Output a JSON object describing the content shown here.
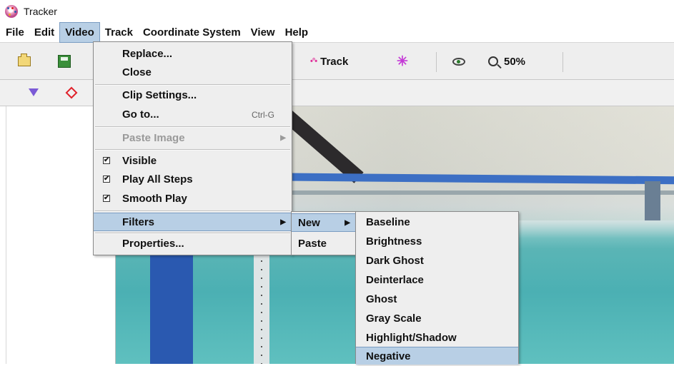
{
  "window": {
    "title": "Tracker"
  },
  "menubar": [
    "File",
    "Edit",
    "Video",
    "Track",
    "Coordinate System",
    "View",
    "Help"
  ],
  "toolbar": {
    "track_label": "Track",
    "zoom_label": "50%"
  },
  "video_menu": {
    "replace": "Replace...",
    "close": "Close",
    "clip_settings": "Clip Settings...",
    "go_to": "Go to...",
    "go_to_shortcut": "Ctrl-G",
    "paste_image": "Paste Image",
    "visible": "Visible",
    "play_all_steps": "Play All Steps",
    "smooth_play": "Smooth Play",
    "filters": "Filters",
    "properties": "Properties..."
  },
  "filters_menu": {
    "new": "New",
    "paste": "Paste"
  },
  "new_menu": [
    "Baseline",
    "Brightness",
    "Dark Ghost",
    "Deinterlace",
    "Ghost",
    "Gray Scale",
    "Highlight/Shadow",
    "Negative"
  ],
  "colors": {
    "highlight": "#b8cfe5",
    "menu_bg": "#eeeeee"
  }
}
